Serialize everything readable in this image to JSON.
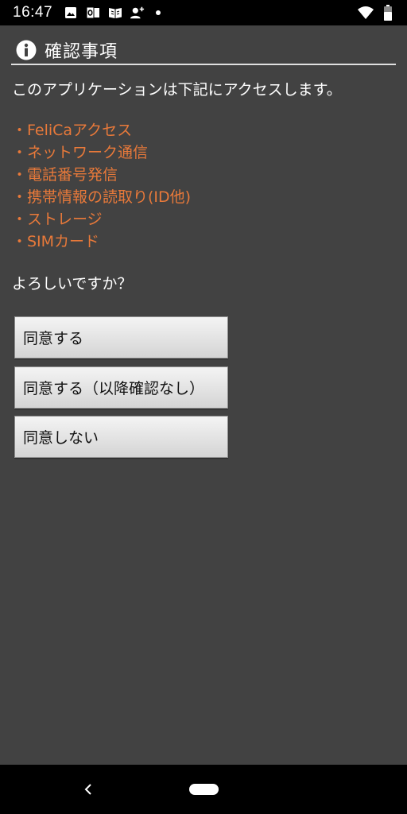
{
  "status_bar": {
    "time": "16:47",
    "icons": [
      "image-icon",
      "outlook-icon",
      "book-icon",
      "add-person-icon",
      "notification-dot-icon",
      "wifi-icon",
      "battery-icon"
    ]
  },
  "dialog": {
    "title": "確認事項",
    "intro": "このアプリケーションは下記にアクセスします。",
    "permissions": [
      "・FeliCaアクセス",
      "・ネットワーク通信",
      "・電話番号発信",
      "・携帯情報の読取り(ID他)",
      "・ストレージ",
      "・SIMカード"
    ],
    "question": "よろしいですか？",
    "buttons": {
      "agree": "同意する",
      "agree_no_confirm": "同意する（以降確認なし）",
      "disagree": "同意しない"
    }
  },
  "colors": {
    "background": "#424242",
    "permission_text": "#e8793a",
    "text": "#ffffff"
  }
}
